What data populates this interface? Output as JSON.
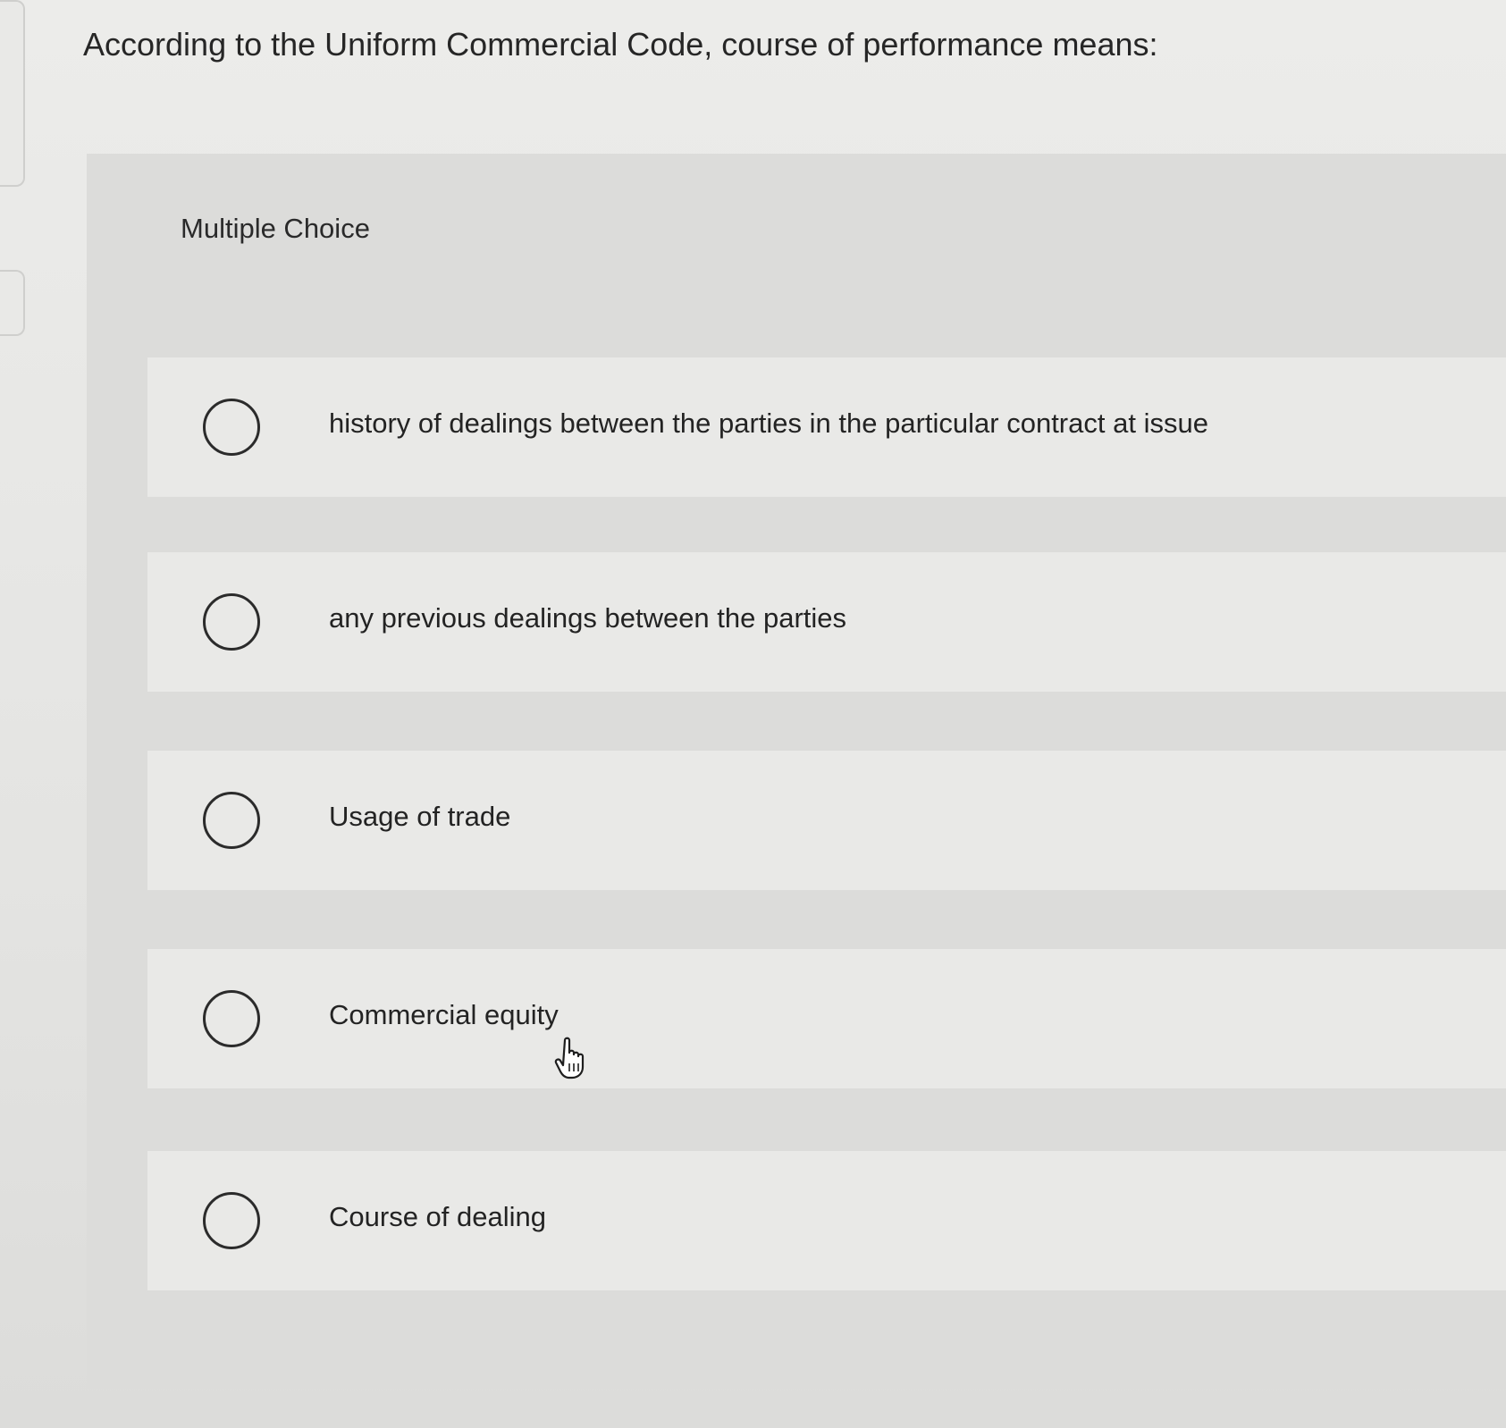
{
  "question": {
    "text": "According to the Uniform Commercial Code, course of performance means:"
  },
  "quiz": {
    "type_label": "Multiple Choice",
    "options": [
      {
        "label": "history of dealings between the parties in the particular contract at issue",
        "selected": false
      },
      {
        "label": "any previous dealings between the parties",
        "selected": false
      },
      {
        "label": "Usage of trade",
        "selected": false
      },
      {
        "label": "Commercial equity",
        "selected": false
      },
      {
        "label": "Course of dealing",
        "selected": false
      }
    ]
  },
  "cursor": {
    "icon": "hand-pointer-icon"
  }
}
